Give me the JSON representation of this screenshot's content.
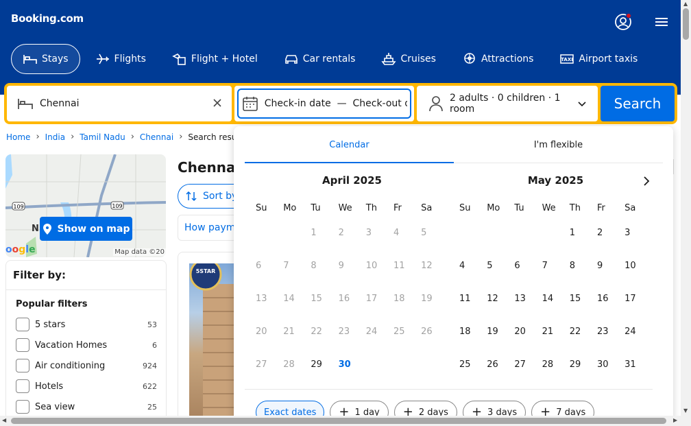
{
  "brand": {
    "logo": "Booking.com",
    "primary": "#003b95",
    "accent": "#006ce4",
    "highlight": "#ffb700"
  },
  "nav": [
    {
      "label": "Stays",
      "icon": "bed-icon",
      "active": true
    },
    {
      "label": "Flights",
      "icon": "plane-icon"
    },
    {
      "label": "Flight + Hotel",
      "icon": "flight-hotel-icon"
    },
    {
      "label": "Car rentals",
      "icon": "car-icon"
    },
    {
      "label": "Cruises",
      "icon": "ship-icon"
    },
    {
      "label": "Attractions",
      "icon": "attractions-icon"
    },
    {
      "label": "Airport taxis",
      "icon": "taxi-icon"
    }
  ],
  "search": {
    "destination": "Chennai",
    "dates": "Check-in date  —  Check-out da",
    "guests": "2 adults · 0 children · 1 room",
    "button": "Search"
  },
  "breadcrumb": {
    "items": [
      "Home",
      "India",
      "Tamil Nadu",
      "Chennai"
    ],
    "current": "Search results"
  },
  "map": {
    "button": "Show on map",
    "credit": "Map data ©20",
    "route_label": "109",
    "letter": "N"
  },
  "filters": {
    "title": "Filter by:",
    "section": "Popular filters",
    "items": [
      {
        "label": "5 stars",
        "count": "53"
      },
      {
        "label": "Vacation Homes",
        "count": "6"
      },
      {
        "label": "Air conditioning",
        "count": "924"
      },
      {
        "label": "Hotels",
        "count": "622"
      },
      {
        "label": "Sea view",
        "count": "25"
      }
    ]
  },
  "results": {
    "title": "Chennai:",
    "sort": "Sort by",
    "payment": "How payme"
  },
  "calendar": {
    "tabs": [
      "Calendar",
      "I'm flexible"
    ],
    "weekdays": [
      "Su",
      "Mo",
      "Tu",
      "We",
      "Th",
      "Fr",
      "Sa"
    ],
    "months": [
      {
        "title": "April 2025",
        "offset": 2,
        "days": 30,
        "last_past": 28,
        "today": 30
      },
      {
        "title": "May 2025",
        "offset": 4,
        "days": 31,
        "last_past": 0,
        "today": 0
      }
    ],
    "chips": [
      "Exact dates",
      "1 day",
      "2 days",
      "3 days",
      "7 days"
    ]
  }
}
